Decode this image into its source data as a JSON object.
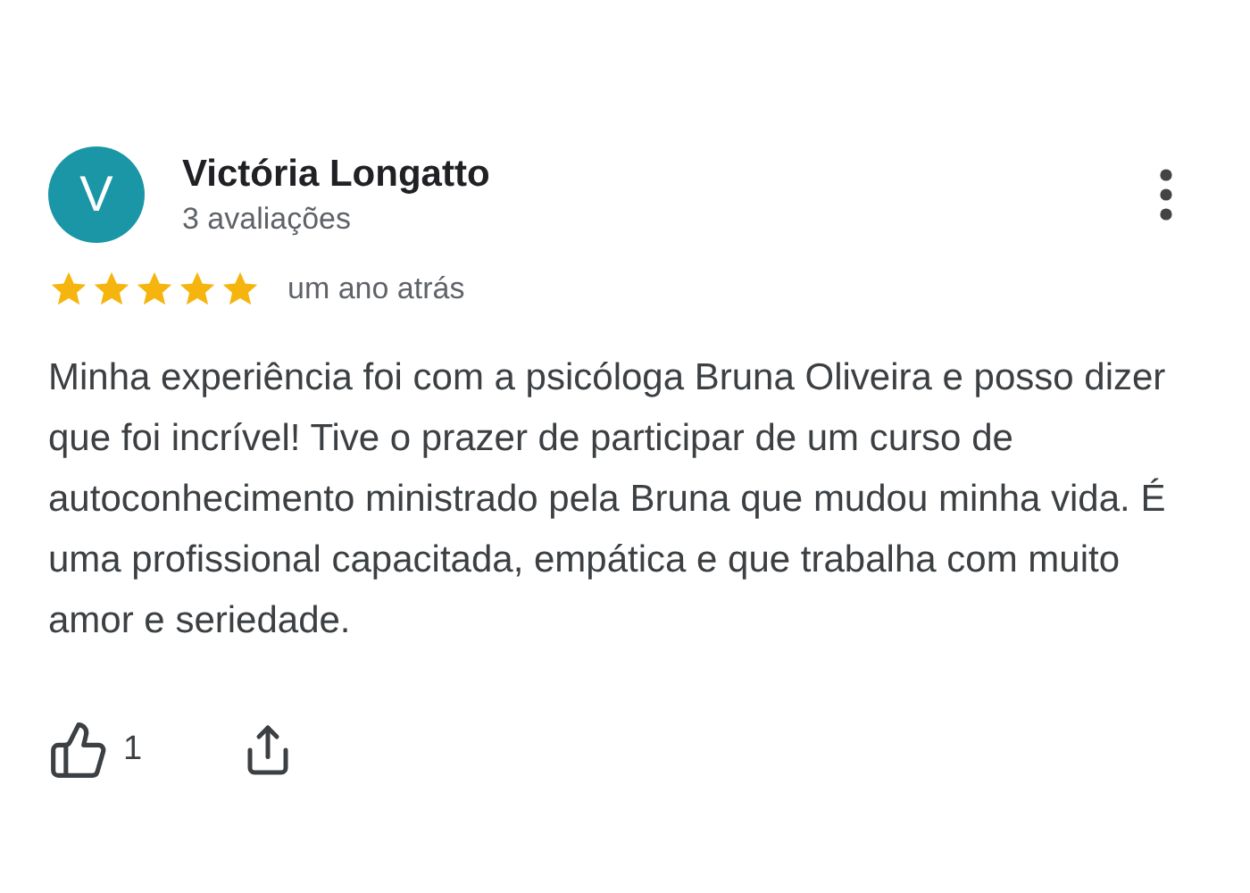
{
  "review": {
    "avatar_letter": "V",
    "author": "Victória Longatto",
    "reviews_count": "3 avaliações",
    "stars": 5,
    "time": "um ano atrás",
    "text": "Minha experiência foi com a psicóloga Bruna Oliveira e posso dizer que foi incrível! Tive o prazer de participar de um curso de autoconhecimento ministrado pela Bruna que mudou minha vida. É uma profissional capacitada, empática e que trabalha com muito amor e seriedade.",
    "likes": "1"
  }
}
